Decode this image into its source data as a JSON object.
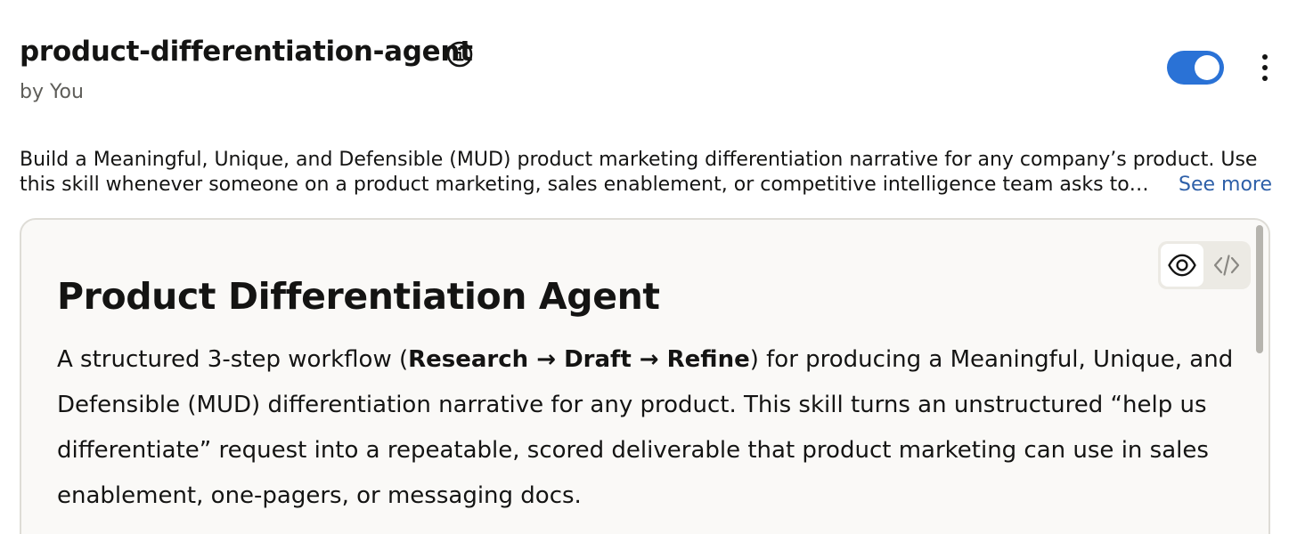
{
  "header": {
    "title": "product-differentiation-agent",
    "author": "by You",
    "toggle_state": "on",
    "toggle_color": "#2a72d6"
  },
  "icons": {
    "info": "info-icon",
    "menu": "more-vertical-icon",
    "preview": "eye-icon",
    "code": "code-icon"
  },
  "description": {
    "line1": "Build a Meaningful, Unique, and Defensible (MUD) product marketing differentiation narrative for any company’s product. Use",
    "line2": "this skill whenever someone on a product marketing, sales enablement, or competitive intelligence team asks to…",
    "see_more": "See more",
    "link_color": "#2d5fa8"
  },
  "document": {
    "title": "Product Differentiation Agent",
    "intro_before": "A structured 3-step workflow (",
    "workflow_steps": "Research → Draft → Refine",
    "intro_after": ") for producing a Meaningful, Unique, and",
    "line2": "Defensible (MUD) differentiation narrative for any product. This skill turns an unstructured “help us",
    "line3": "differentiate” request into a repeatable, scored deliverable that product marketing can use in sales",
    "line4": "enablement, one-pagers, or messaging docs."
  }
}
